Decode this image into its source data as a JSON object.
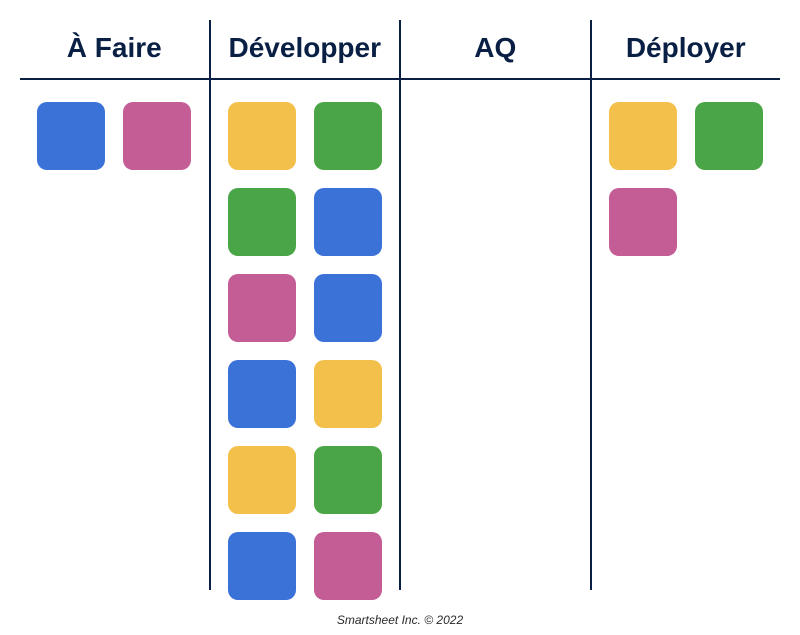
{
  "colors": {
    "blue": "#3a72d8",
    "pink": "#c45c96",
    "yellow": "#f2c04b",
    "green": "#4aa547",
    "ink": "#0a1f44"
  },
  "columns": [
    {
      "id": "todo",
      "title": "À Faire",
      "cards": [
        "blue",
        "pink"
      ]
    },
    {
      "id": "develop",
      "title": "Développer",
      "cards": [
        "yellow",
        "green",
        "green",
        "blue",
        "pink",
        "blue",
        "blue",
        "yellow",
        "yellow",
        "green",
        "blue",
        "pink"
      ]
    },
    {
      "id": "qa",
      "title": "AQ",
      "cards": []
    },
    {
      "id": "deploy",
      "title": "Déployer",
      "cards": [
        "yellow",
        "green",
        "pink",
        ""
      ]
    }
  ],
  "footer": "Smartsheet Inc. © 2022"
}
